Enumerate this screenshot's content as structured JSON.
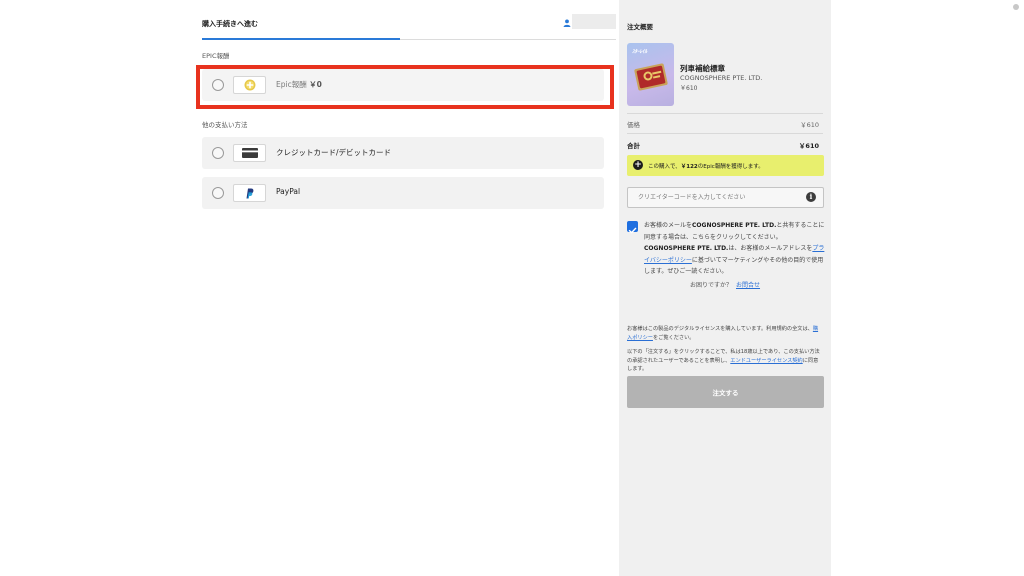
{
  "header": {
    "title": "購入手続きへ進む"
  },
  "payment": {
    "epic_section_label": "EPIC報酬",
    "epic_option": {
      "label": "Epic報酬",
      "amount": "￥0"
    },
    "other_section_label": "他の支払い方法",
    "methods": [
      {
        "label": "クレジットカード/デビットカード",
        "icon": "credit-card-icon"
      },
      {
        "label": "PayPal",
        "icon": "paypal-icon"
      }
    ]
  },
  "summary": {
    "title": "注文概要",
    "product": {
      "name": "列車補給標章",
      "publisher": "COGNOSPHERE PTE. LTD.",
      "price": "￥610",
      "thumb_text": "ｽﾀｰﾚｲﾙ"
    },
    "price_label": "価格",
    "price_value": "￥610",
    "total_label": "合計",
    "total_value": "￥610",
    "reward_prefix": "この購入で、",
    "reward_amount": "￥122",
    "reward_suffix": "のEpic報酬を獲得します。",
    "creator_placeholder": "クリエイターコードを入力してください",
    "consent": {
      "t1": "お客様のメールを",
      "b1": "COGNOSPHERE PTE. LTD.",
      "t2": "と共有することに同意する場合は、こちらをクリックしてください。",
      "b2": "COGNOSPHERE PTE. LTD.",
      "t3": "は、お客様のメールアドレスを",
      "link": "プライバシーポリシー",
      "t4": "に基づいてマーケティングやその他の目的で使用します。ぜひご一読ください。"
    },
    "help_text": "お困りですか？",
    "help_link": "お問合せ",
    "license1_text": "お客様はこの製品のデジタルライセンスを購入しています。利用規約の全文は、",
    "license1_link": "購入ポリシー",
    "license1_suffix": "をご覧ください。",
    "license2_text": "以下の「注文する」をクリックすることで、私は18歳以上であり、この支払い方法の承認されたユーザーであることを表明し、",
    "license2_link": "エンドユーザーライセンス契約",
    "license2_suffix": "に同意します。",
    "order_button": "注文する"
  },
  "colors": {
    "accent": "#2a7ad8",
    "highlight_border": "#e8321e",
    "reward_bar": "#e8ef6e",
    "order_button_disabled": "#b3b3b3"
  }
}
